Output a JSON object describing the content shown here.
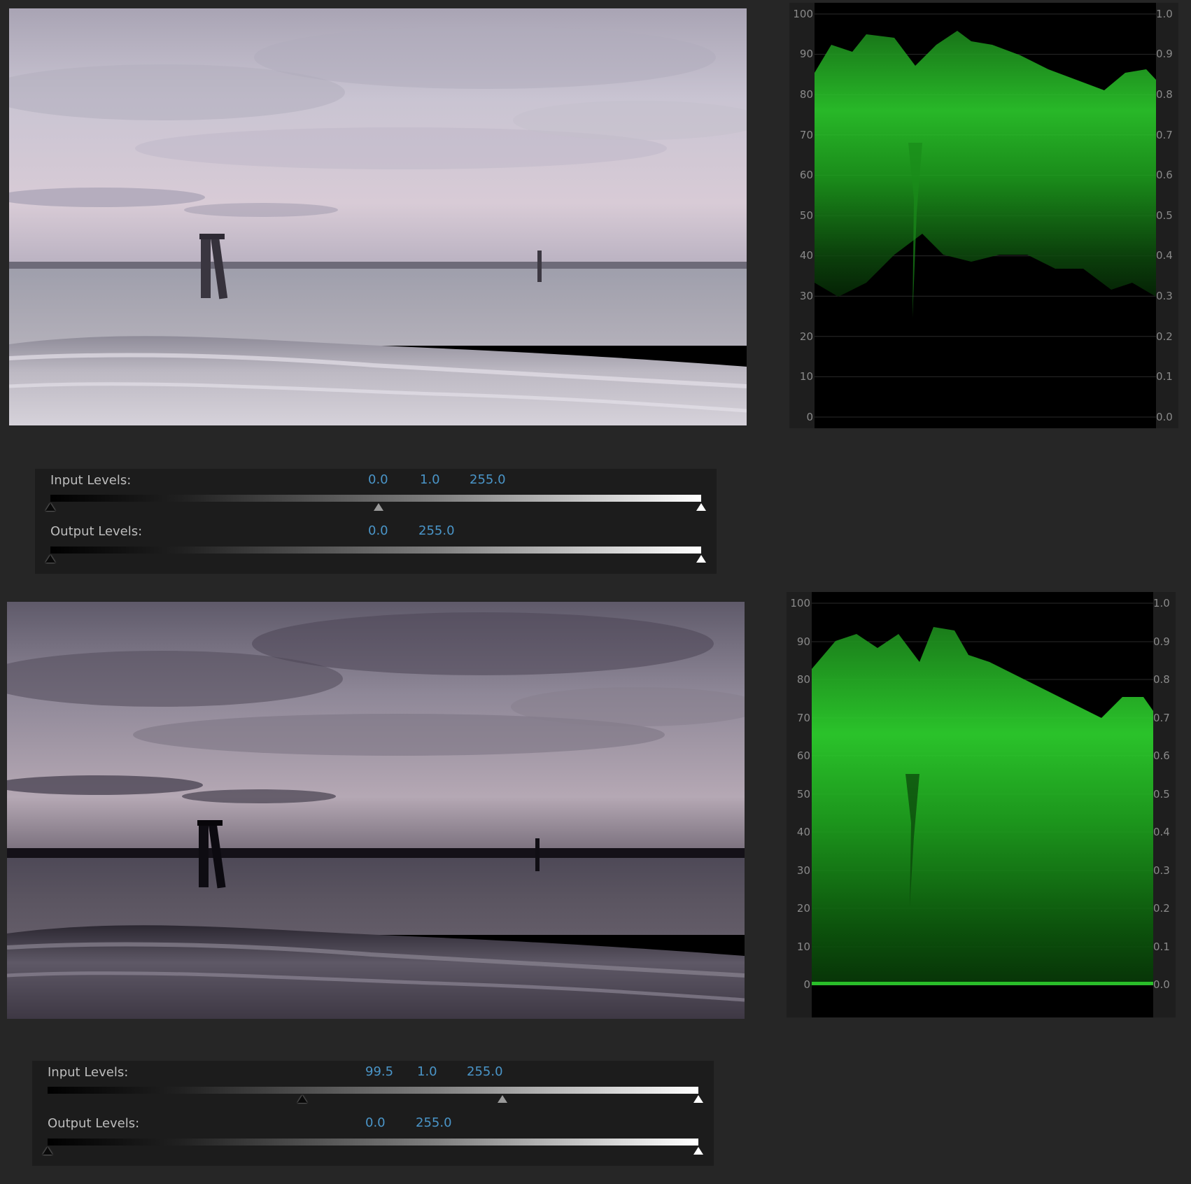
{
  "scope": {
    "left_ticks": [
      "100",
      "90",
      "80",
      "70",
      "60",
      "50",
      "40",
      "30",
      "20",
      "10",
      "0"
    ],
    "right_ticks": [
      "1.0",
      "0.9",
      "0.8",
      "0.7",
      "0.6",
      "0.5",
      "0.4",
      "0.3",
      "0.2",
      "0.1",
      "0.0"
    ],
    "trace_color": "#2fd82f"
  },
  "panels": [
    {
      "input_levels_label": "Input Levels:",
      "output_levels_label": "Output Levels:",
      "input": {
        "black": "0.0",
        "gamma": "1.0",
        "white": "255.0"
      },
      "output": {
        "black": "0.0",
        "white": "255.0"
      }
    },
    {
      "input_levels_label": "Input Levels:",
      "output_levels_label": "Output Levels:",
      "input": {
        "black": "99.5",
        "gamma": "1.0",
        "white": "255.0"
      },
      "output": {
        "black": "0.0",
        "white": "255.0"
      }
    }
  ]
}
